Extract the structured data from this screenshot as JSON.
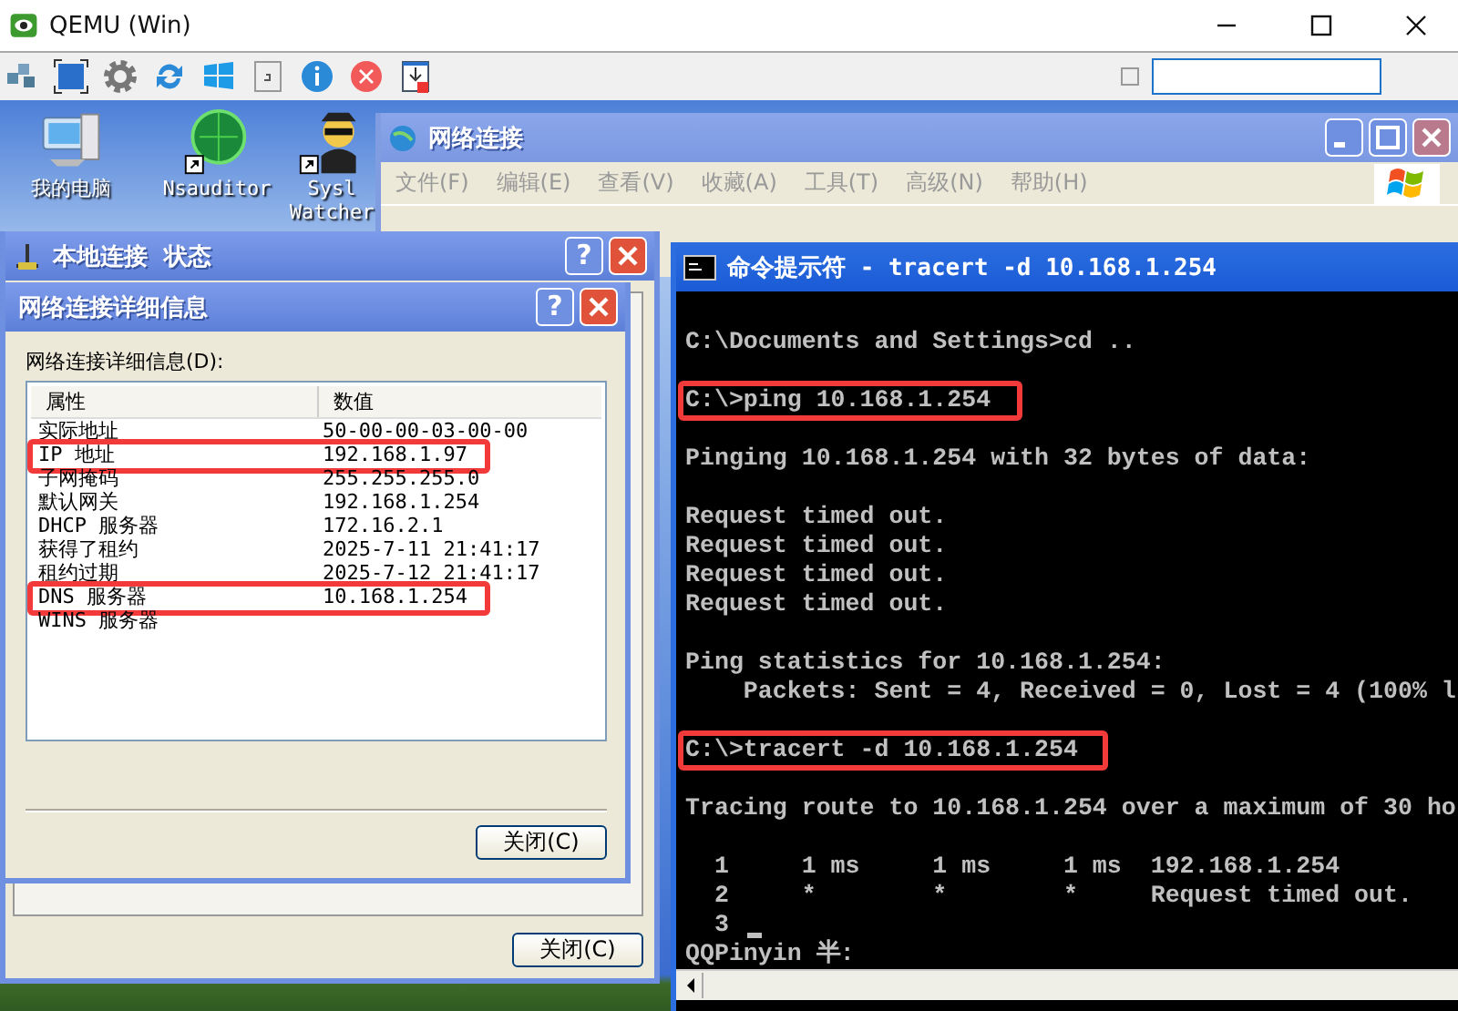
{
  "host_window": {
    "title": "QEMU (Win)"
  },
  "host_toolbar": {
    "checkbox": {
      "checked": false
    }
  },
  "desktop_icons": [
    {
      "label": "我的电脑",
      "kind": "computer"
    },
    {
      "label": "Nsauditor",
      "kind": "ns"
    },
    {
      "label": "Sysl Watcher",
      "kind": "agent"
    }
  ],
  "explorer_window": {
    "title": "网络连接",
    "menu": [
      "文件(F)",
      "编辑(E)",
      "查看(V)",
      "收藏(A)",
      "工具(T)",
      "高级(N)",
      "帮助(H)"
    ]
  },
  "status_window": {
    "title": "本地连接  状态",
    "help_label": "?",
    "close_button": "关闭(C)"
  },
  "details_dialog": {
    "title": "网络连接详细信息",
    "help_label": "?",
    "list_label": "网络连接详细信息(D):",
    "columns": [
      "属性",
      "数值"
    ],
    "rows": [
      {
        "property": "实际地址",
        "value": "50-00-00-03-00-00",
        "highlighted": false
      },
      {
        "property": "IP 地址",
        "value": "192.168.1.97",
        "highlighted": true
      },
      {
        "property": "子网掩码",
        "value": "255.255.255.0",
        "highlighted": false
      },
      {
        "property": "默认网关",
        "value": "192.168.1.254",
        "highlighted": false
      },
      {
        "property": "DHCP 服务器",
        "value": "172.16.2.1",
        "highlighted": false
      },
      {
        "property": "获得了租约",
        "value": "2025-7-11 21:41:17",
        "highlighted": false
      },
      {
        "property": "租约过期",
        "value": "2025-7-12 21:41:17",
        "highlighted": false
      },
      {
        "property": "DNS 服务器",
        "value": "10.168.1.254",
        "highlighted": true
      },
      {
        "property": "WINS 服务器",
        "highlighted": false
      }
    ],
    "close_button": "关闭(C)"
  },
  "console": {
    "title": "命令提示符 - tracert -d 10.168.1.254",
    "blocks": [
      {
        "highlighted": false,
        "lines": [
          {
            "text": "C:\\Documents and Settings>cd .."
          }
        ]
      },
      {
        "highlighted": true,
        "lines": [
          {
            "text": "C:\\>ping 10.168.1.254"
          }
        ]
      },
      {
        "highlighted": false,
        "lines": [
          {
            "text": "Pinging 10.168.1.254 with 32 bytes of data:"
          }
        ]
      },
      {
        "highlighted": false,
        "lines": [
          {
            "text": "Request timed out."
          },
          {
            "text": "Request timed out."
          },
          {
            "text": "Request timed out."
          },
          {
            "text": "Request timed out."
          }
        ]
      },
      {
        "highlighted": false,
        "lines": [
          {
            "text": "Ping statistics for 10.168.1.254:"
          },
          {
            "text": "    Packets: Sent = 4, Received = 0, Lost = 4 (100% l"
          }
        ]
      },
      {
        "highlighted": true,
        "lines": [
          {
            "text": "C:\\>tracert -d 10.168.1.254"
          }
        ]
      },
      {
        "highlighted": false,
        "lines": [
          {
            "text": "Tracing route to 10.168.1.254 over a maximum of 30 ho"
          }
        ]
      },
      {
        "highlighted": false,
        "lines": [
          {
            "text": "  1     1 ms     1 ms     1 ms  192.168.1.254"
          },
          {
            "text": "  2     *        *        *     Request timed out."
          },
          {
            "text": "  3",
            "cursor": true
          },
          {
            "text": "QQPinyin 半:"
          }
        ]
      }
    ]
  }
}
